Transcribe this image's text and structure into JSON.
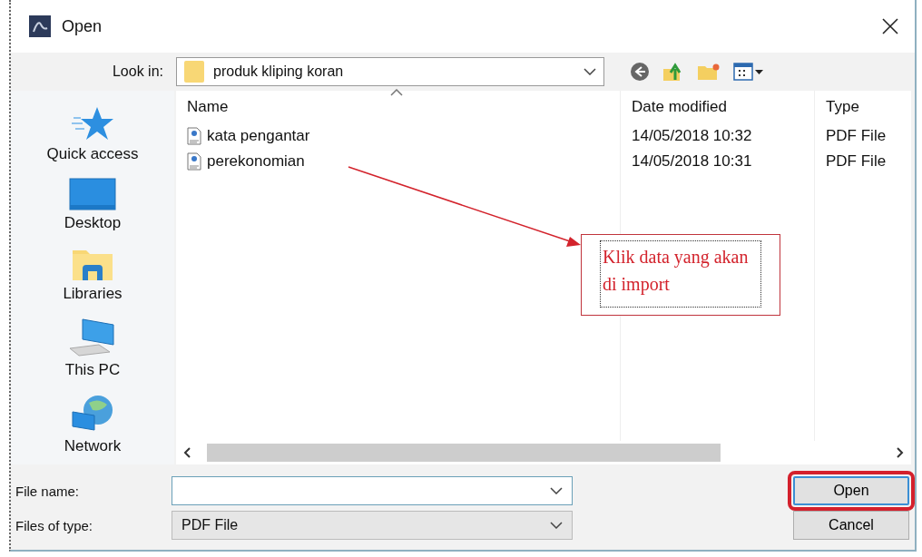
{
  "window": {
    "title": "Open"
  },
  "look_in": {
    "label": "Look in:",
    "value": "produk kliping koran"
  },
  "places": [
    {
      "label": "Quick access",
      "kind": "star"
    },
    {
      "label": "Desktop",
      "kind": "desktop"
    },
    {
      "label": "Libraries",
      "kind": "libraries"
    },
    {
      "label": "This PC",
      "kind": "pc"
    },
    {
      "label": "Network",
      "kind": "network"
    }
  ],
  "file_list": {
    "columns": [
      "Name",
      "Date modified",
      "Type"
    ],
    "rows": [
      {
        "name": "kata pengantar",
        "date": "14/05/2018 10:32",
        "type": "PDF File"
      },
      {
        "name": "perekonomian",
        "date": "14/05/2018 10:31",
        "type": "PDF File"
      }
    ]
  },
  "annotation": {
    "text": "Klik data yang akan di import"
  },
  "file_name": {
    "label": "File name:"
  },
  "file_type": {
    "label": "Files of type:",
    "value": "PDF File"
  },
  "buttons": [
    {
      "label": "Open",
      "circled": true
    },
    {
      "label": "Cancel",
      "circled": false
    }
  ]
}
